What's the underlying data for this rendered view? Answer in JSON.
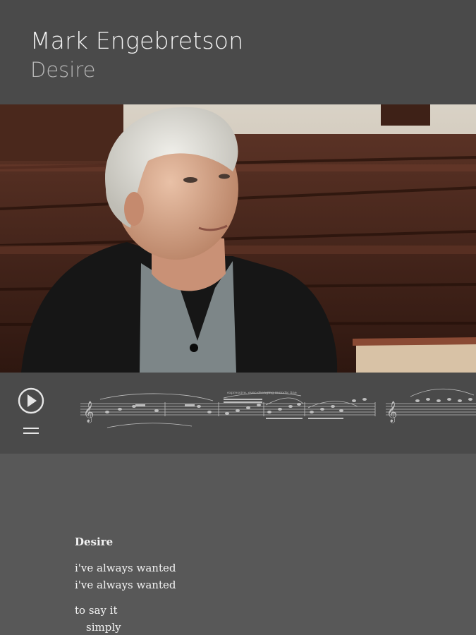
{
  "header": {
    "composer": "Mark Engebretson",
    "title": "Desire"
  },
  "video": {
    "subject": "interview-video-frame"
  },
  "player": {
    "play_icon": "play-circle-icon",
    "menu_icon": "menu-icon",
    "score_annotation": "expressive, ever-changing melodic line"
  },
  "poem": {
    "title": "Desire",
    "lines": [
      "i've always wanted",
      "i've always wanted",
      "to say it",
      "simply"
    ]
  },
  "colors": {
    "header_bg": "#4a4a4a",
    "content_bg": "#585858",
    "text_primary": "#f4f4f4",
    "text_secondary": "#b8b8b8"
  }
}
